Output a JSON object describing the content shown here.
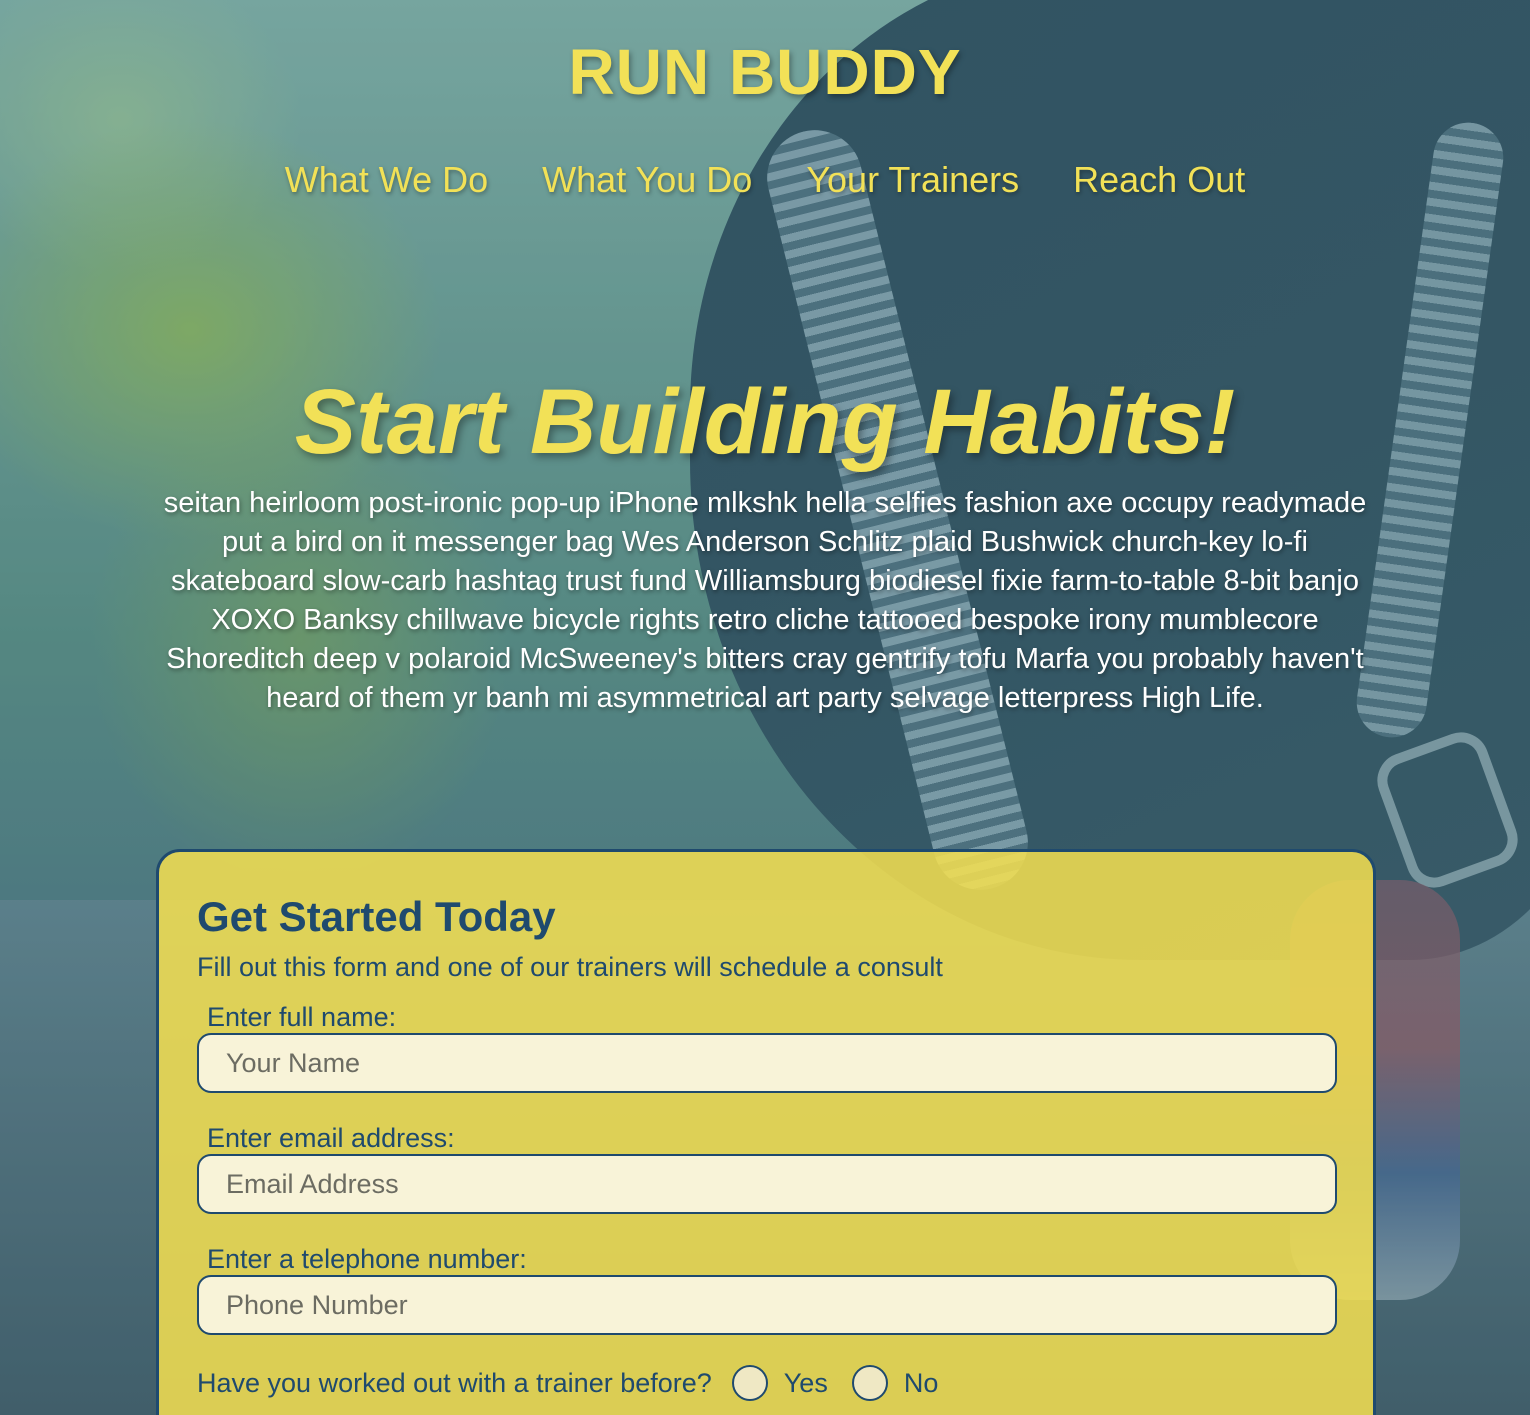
{
  "header": {
    "title": "RUN BUDDY",
    "nav": [
      {
        "label": "What We Do"
      },
      {
        "label": "What You Do"
      },
      {
        "label": "Your Trainers"
      },
      {
        "label": "Reach Out"
      }
    ]
  },
  "hero": {
    "heading": "Start Building Habits!",
    "text": "seitan heirloom post-ironic pop-up iPhone mlkshk hella selfies fashion axe occupy readymade put a bird on it messenger bag Wes Anderson Schlitz plaid Bushwick church-key lo-fi skateboard slow-carb hashtag trust fund Williamsburg biodiesel fixie farm-to-table 8-bit banjo XOXO Banksy chillwave bicycle rights retro cliche tattooed bespoke irony mumblecore Shoreditch deep v polaroid McSweeney's bitters cray gentrify tofu Marfa you probably haven't heard of them yr banh mi asymmetrical art party selvage letterpress High Life."
  },
  "form": {
    "title": "Get Started Today",
    "subtitle": "Fill out this form and one of our trainers will schedule a consult",
    "fields": [
      {
        "label": "Enter full name:",
        "placeholder": "Your Name",
        "value": ""
      },
      {
        "label": "Enter email address:",
        "placeholder": "Email Address",
        "value": ""
      },
      {
        "label": "Enter a telephone number:",
        "placeholder": "Phone Number",
        "value": ""
      }
    ],
    "trainer_question": {
      "label": "Have you worked out with a trainer before?",
      "options": [
        {
          "label": "Yes",
          "selected": false
        },
        {
          "label": "No",
          "selected": false
        }
      ]
    }
  },
  "colors": {
    "accent": "#f2e157",
    "form_background": "#f5e050",
    "form_text": "#1f4a6e",
    "input_background": "#f8f3d8"
  }
}
